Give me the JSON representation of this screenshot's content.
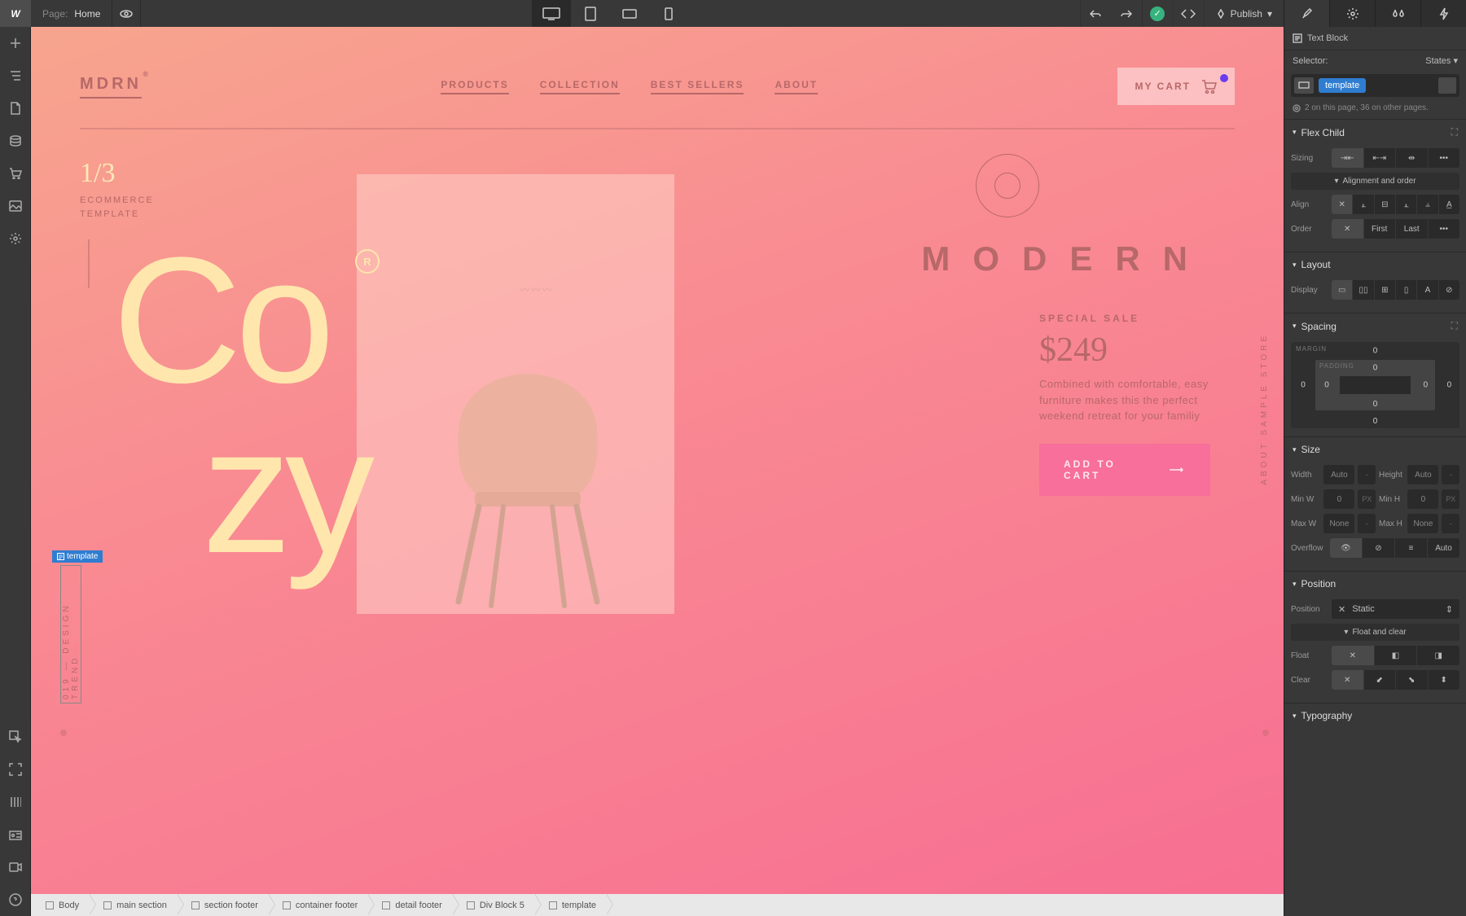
{
  "topbar": {
    "page_label": "Page:",
    "page_name": "Home",
    "publish": "Publish"
  },
  "right_tabs": [
    "brush",
    "settings",
    "drops",
    "bolt"
  ],
  "selected_element": {
    "type_label": "Text Block",
    "selector_label": "Selector:",
    "states_label": "States",
    "class_chip": "template",
    "usage": "2 on this page, 36 on other pages."
  },
  "selection_badge": "template",
  "panels": {
    "flex_child": {
      "title": "Flex Child",
      "sizing": "Sizing",
      "align_order": "Alignment and order",
      "align": "Align",
      "order": "Order",
      "first": "First",
      "last": "Last"
    },
    "layout": {
      "title": "Layout",
      "display": "Display"
    },
    "spacing": {
      "title": "Spacing",
      "margin": "MARGIN",
      "padding": "PADDING",
      "m_top": "0",
      "m_right": "0",
      "m_bottom": "0",
      "m_left": "0",
      "p_top": "0",
      "p_right": "0",
      "p_bottom": "0",
      "p_left": "0"
    },
    "size": {
      "title": "Size",
      "width": "Width",
      "height": "Height",
      "minw": "Min W",
      "minh": "Min H",
      "maxw": "Max W",
      "maxh": "Max H",
      "auto": "Auto",
      "zero": "0",
      "none": "None",
      "px": "PX",
      "overflow": "Overflow",
      "overflow_auto": "Auto"
    },
    "position": {
      "title": "Position",
      "position": "Position",
      "static": "Static",
      "float_clear": "Float and clear",
      "float": "Float",
      "clear": "Clear"
    },
    "typography": {
      "title": "Typography"
    }
  },
  "site": {
    "brand": "MDRN",
    "brand_mark": "®",
    "nav": [
      "PRODUCTS",
      "COLLECTION",
      "BEST SELLERS",
      "ABOUT"
    ],
    "cart": "MY CART",
    "slide_num": "1/3",
    "slide_label_1": "ECOMMERCE",
    "slide_label_2": "TEMPLATE",
    "hero_word_1": "Co",
    "hero_word_2": "zy",
    "r_badge": "R",
    "modern": "MODERN",
    "zigzag": "〰〰〰",
    "sale_label": "SPECIAL SALE",
    "price": "$249",
    "desc": "Combined with comfortable, easy furniture makes this the perfect weekend retreat for your familiy",
    "add_cart": "ADD TO CART",
    "about_vert": "ABOUT SAMPLE STORE",
    "trend_vert": "019 — DESIGN TREND"
  },
  "breadcrumb": [
    "Body",
    "main section",
    "section footer",
    "container footer",
    "detail footer",
    "Div Block 5",
    "template"
  ]
}
